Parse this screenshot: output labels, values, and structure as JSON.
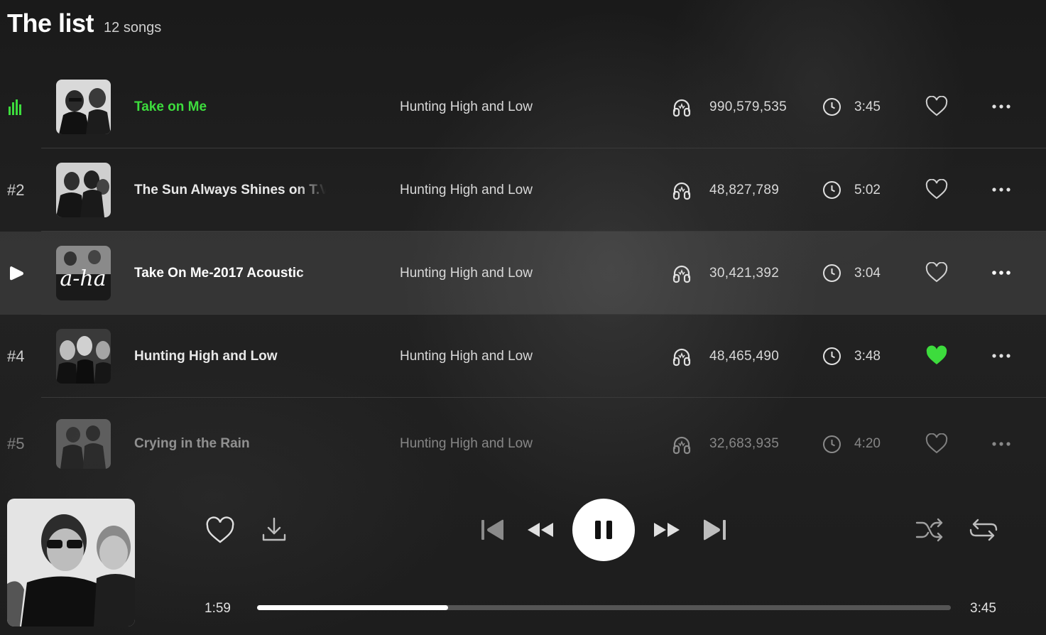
{
  "header": {
    "title": "The list",
    "count": "12 songs"
  },
  "songs": [
    {
      "index": "",
      "index_icon": "equalizer-icon",
      "title": "Take on Me",
      "album": "Hunting High and Low",
      "plays": "990,579,535",
      "duration": "3:45",
      "liked": false,
      "playing": true
    },
    {
      "index": "#2",
      "title": "The Sun Always Shines on T.V.",
      "album": "Hunting High and Low",
      "plays": "48,827,789",
      "duration": "5:02",
      "liked": false
    },
    {
      "index": "",
      "index_icon": "play-icon",
      "title": "Take On Me-2017 Acoustic",
      "album": "Hunting High and Low",
      "plays": "30,421,392",
      "duration": "3:04",
      "liked": false,
      "hovered": true,
      "thumb_text": "a-ha"
    },
    {
      "index": "#4",
      "title": "Hunting High and Low",
      "album": "Hunting High and Low",
      "plays": "48,465,490",
      "duration": "3:48",
      "liked": true
    },
    {
      "index": "#5",
      "title": "Crying in the Rain",
      "album": "Hunting High and Low",
      "plays": "32,683,935",
      "duration": "4:20",
      "liked": false
    }
  ],
  "player": {
    "elapsed": "1:59",
    "total": "3:45",
    "progress": 0.275,
    "state": "playing"
  },
  "colors": {
    "accent": "#3ddc3d",
    "background": "#1e1e1e",
    "separator": "#3a3a3a"
  }
}
